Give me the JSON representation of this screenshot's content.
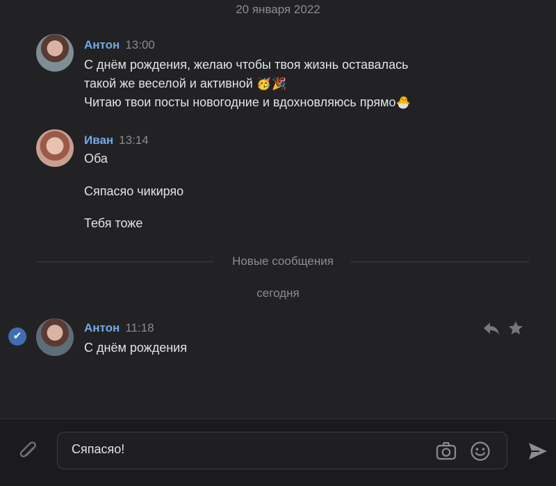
{
  "date_header": "20 января 2022",
  "messages": [
    {
      "author": "Антон",
      "time": "13:00",
      "lines": [
        "С днём рождения, желаю чтобы твоя жизнь оставалась",
        "такой же веселой и активной",
        "Читаю твои посты новогодние и вдохновляюсь прямо"
      ],
      "emoji": [
        "🥳",
        "🎉",
        "🐣"
      ]
    },
    {
      "author": "Иван",
      "time": "13:14",
      "lines": [
        "Оба",
        "Сяпасяо чикиряо",
        "Тебя тоже"
      ]
    },
    {
      "author": "Антон",
      "time": "11:18",
      "lines": [
        "С днём рождения"
      ]
    }
  ],
  "divider_label": "Новые сообщения",
  "today_label": "сегодня",
  "composer": {
    "value": "Сяпасяо!"
  },
  "icons": {
    "selected_check": "check-icon",
    "reply": "reply-icon",
    "favorite": "star-icon",
    "attach": "paperclip-icon",
    "camera": "camera-icon",
    "emoji": "smile-icon",
    "send": "send-icon"
  },
  "colors": {
    "background": "#222224",
    "author": "#71aaeb",
    "muted": "#8a8d92",
    "check": "#3f6fb0"
  }
}
